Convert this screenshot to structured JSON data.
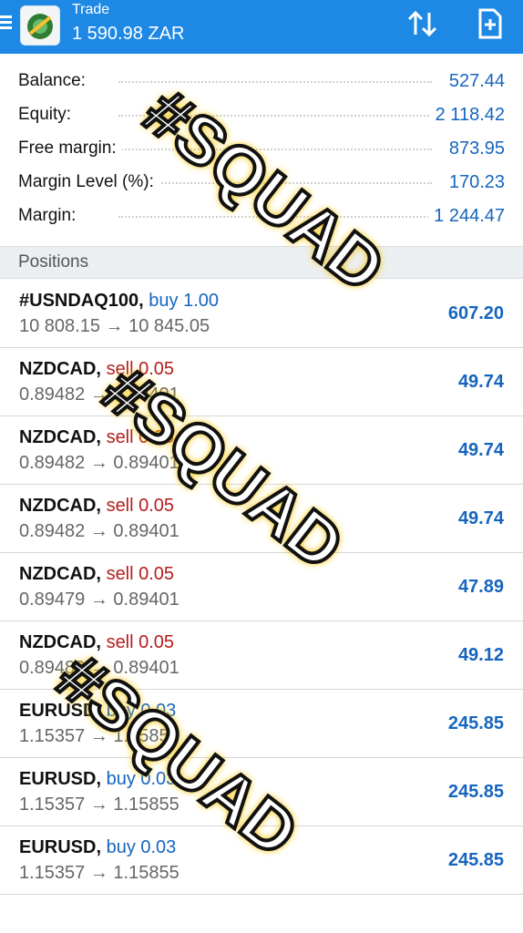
{
  "header": {
    "title": "Trade",
    "balance_line": "1 590.98 ZAR",
    "icons": [
      "menu-icon",
      "app-logo",
      "sort-icon",
      "new-order-icon"
    ]
  },
  "summary": [
    {
      "label": "Balance:",
      "value": "527.44"
    },
    {
      "label": "Equity:",
      "value": "2 118.42"
    },
    {
      "label": "Free margin:",
      "value": "873.95"
    },
    {
      "label": "Margin Level (%):",
      "value": "170.23"
    },
    {
      "label": "Margin:",
      "value": "1 244.47"
    }
  ],
  "positions_header": "Positions",
  "positions": [
    {
      "symbol": "#USNDAQ100,",
      "side": "buy 1.00",
      "prices": "10 808.15 → 10 845.05",
      "profit": "607.20"
    },
    {
      "symbol": "NZDCAD,",
      "side": "sell 0.05",
      "prices": "0.89482 → 0.89401",
      "profit": "49.74"
    },
    {
      "symbol": "NZDCAD,",
      "side": "sell 0.05",
      "prices": "0.89482 → 0.89401",
      "profit": "49.74"
    },
    {
      "symbol": "NZDCAD,",
      "side": "sell 0.05",
      "prices": "0.89482 → 0.89401",
      "profit": "49.74"
    },
    {
      "symbol": "NZDCAD,",
      "side": "sell 0.05",
      "prices": "0.89479 → 0.89401",
      "profit": "47.89"
    },
    {
      "symbol": "NZDCAD,",
      "side": "sell 0.05",
      "prices": "0.89482 → 0.89401",
      "profit": "49.12"
    },
    {
      "symbol": "EURUSD,",
      "side": "buy 0.03",
      "prices": "1.15357 → 1.15855",
      "profit": "245.85"
    },
    {
      "symbol": "EURUSD,",
      "side": "buy 0.03",
      "prices": "1.15357 → 1.15855",
      "profit": "245.85"
    },
    {
      "symbol": "EURUSD,",
      "side": "buy 0.03",
      "prices": "1.15357 → 1.15855",
      "profit": "245.85"
    }
  ],
  "watermark": "#SQUAD",
  "colors": {
    "header_bg": "#1e88e5",
    "value_blue": "#1565c0",
    "sell_red": "#b71c1c",
    "watermark_outline": "#f5c400"
  }
}
